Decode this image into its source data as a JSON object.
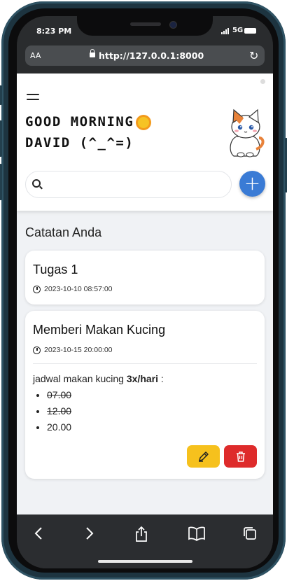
{
  "status_bar": {
    "time": "8:23 PM",
    "network": "5G"
  },
  "browser": {
    "text_size_label": "AA",
    "url": "http://127.0.0.1:8000",
    "toolbar_icons": [
      "back-icon",
      "forward-icon",
      "share-icon",
      "bookmarks-icon",
      "tabs-icon"
    ]
  },
  "header": {
    "greeting_line1": "GOOD MORNING",
    "greeting_line2": "DAVID (^_^=)",
    "search_placeholder": "",
    "add_label": "+"
  },
  "main": {
    "section_title": "Catatan Anda",
    "notes": [
      {
        "title": "Tugas 1",
        "date": "2023-10-10 08:57:00"
      },
      {
        "title": "Memberi Makan Kucing",
        "date": "2023-10-15 20:00:00",
        "body_prefix": "jadwal makan kucing ",
        "body_bold": "3x/hari",
        "body_suffix": " :",
        "items": [
          {
            "text": "07.00",
            "done": true
          },
          {
            "text": "12.00",
            "done": true
          },
          {
            "text": "20.00",
            "done": false
          }
        ]
      }
    ]
  },
  "colors": {
    "accent_blue": "#3a7bd5",
    "edit_yellow": "#f6c11d",
    "delete_red": "#de2b2b",
    "background": "#f0f2f5"
  }
}
